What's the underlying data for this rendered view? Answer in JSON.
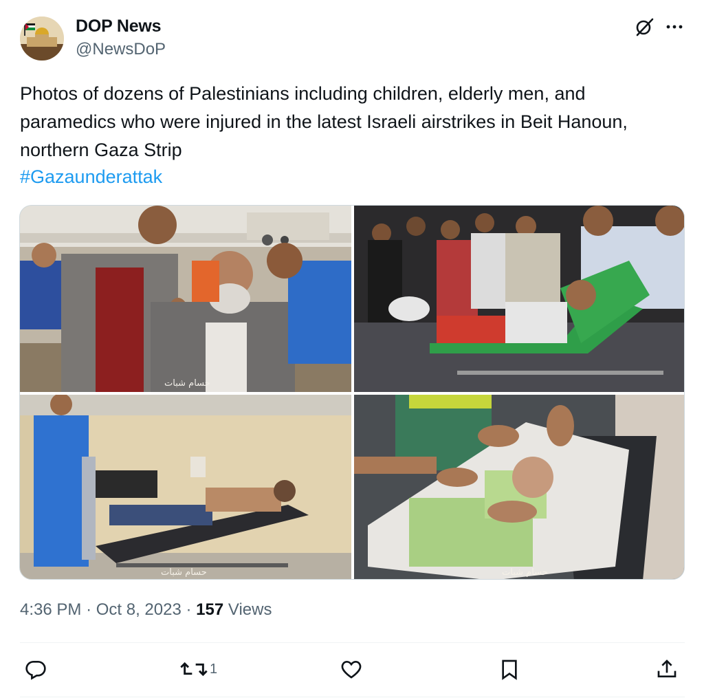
{
  "author": {
    "display_name": "DOP News",
    "handle": "@NewsDoP"
  },
  "tweet": {
    "text": "Photos of dozens of Palestinians including children, elderly men, and paramedics who were injured in the latest Israeli airstrikes in Beit Hanoun, northern Gaza Strip",
    "hashtag": "#Gazaunderattak"
  },
  "media": [
    {
      "watermark": "حسام شبات"
    },
    {
      "watermark": ""
    },
    {
      "watermark": "حسام شبات"
    },
    {
      "watermark": "حسام شبات"
    }
  ],
  "meta": {
    "time": "4:36 PM",
    "separator": "·",
    "date": "Oct 8, 2023",
    "views_count": "157",
    "views_label": "Views"
  },
  "actions": {
    "reply_icon": "reply-icon",
    "retweet_icon": "retweet-icon",
    "retweet_count": "1",
    "like_icon": "heart-icon",
    "bookmark_icon": "bookmark-icon",
    "share_icon": "share-icon"
  },
  "colors": {
    "accent": "#1d9bf0",
    "text": "#0f1419",
    "secondary": "#536471",
    "border": "#cfd9de"
  }
}
